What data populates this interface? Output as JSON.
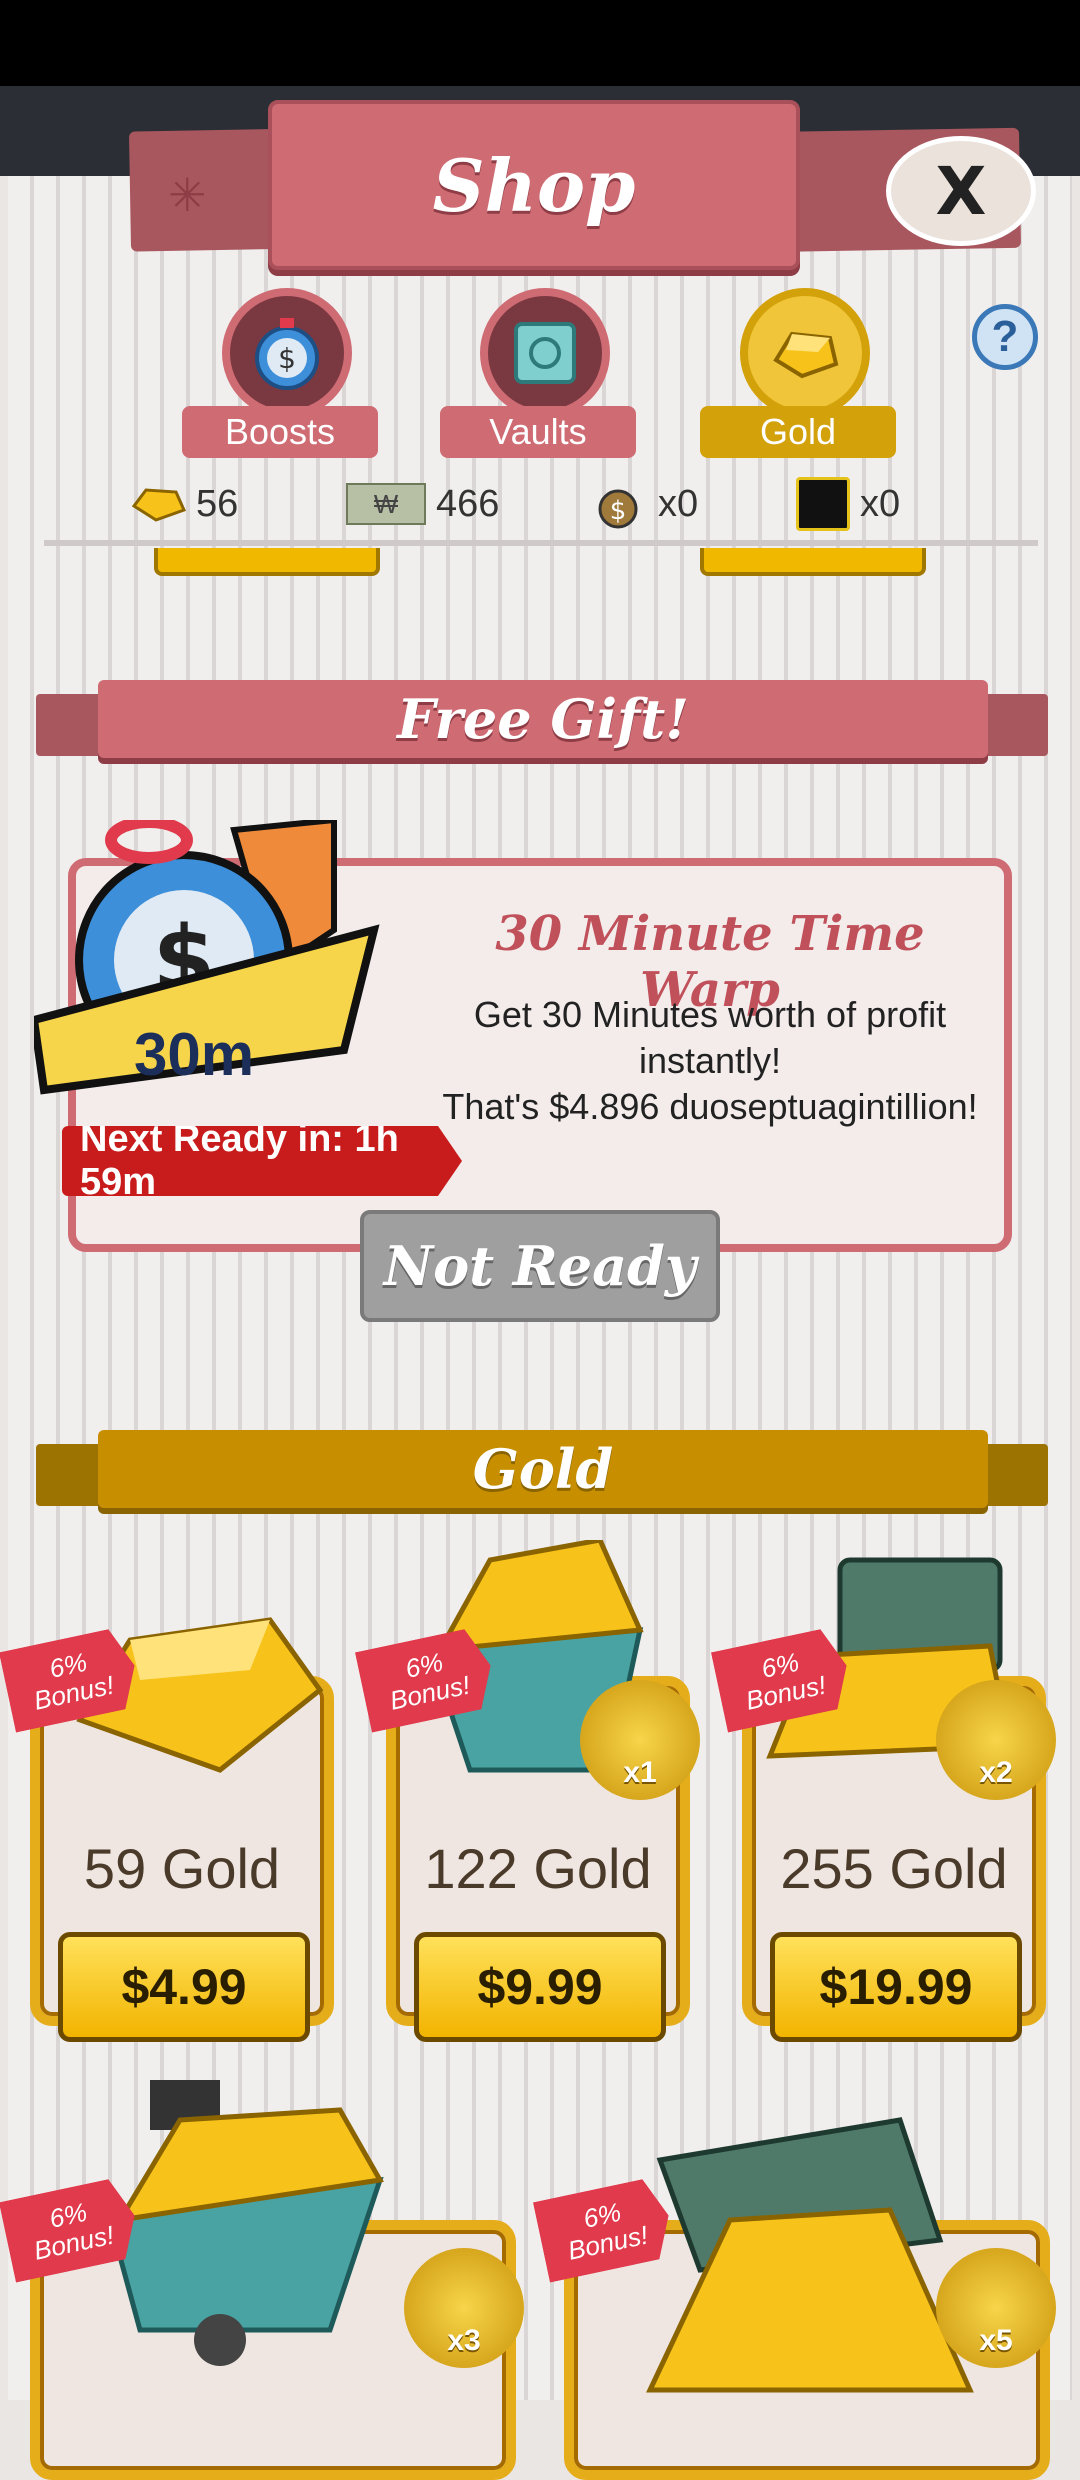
{
  "shop": {
    "title": "Shop",
    "close_label": "X",
    "help_label": "?"
  },
  "tabs": [
    {
      "label": "Boosts",
      "icon": "stopwatch-icon",
      "active": false
    },
    {
      "label": "Vaults",
      "icon": "vault-icon",
      "active": false
    },
    {
      "label": "Gold",
      "icon": "gold-icon",
      "active": true
    }
  ],
  "currencies": [
    {
      "icon": "gold-icon",
      "value": "56"
    },
    {
      "icon": "megabucks-icon",
      "glyph": "₩",
      "value": "466"
    },
    {
      "icon": "moneybag-icon",
      "value": "x0"
    },
    {
      "icon": "badge-icon",
      "value": "x0"
    }
  ],
  "free_gift": {
    "header": "Free Gift!",
    "title": "30 Minute Time Warp",
    "desc_line1": "Get 30 Minutes worth of profit",
    "desc_line2": "instantly!",
    "desc_line3": "That's $4.896 duoseptuagintillion!",
    "icon_label": "30m",
    "next_ready": "Next Ready in: 1h 59m",
    "button": "Not Ready"
  },
  "gold_section": {
    "header": "Gold",
    "items": [
      {
        "amount": "59 Gold",
        "price": "$4.99",
        "bonus_pct": "6%",
        "bonus_word": "Bonus!",
        "multiplier": ""
      },
      {
        "amount": "122 Gold",
        "price": "$9.99",
        "bonus_pct": "6%",
        "bonus_word": "Bonus!",
        "multiplier": "x1"
      },
      {
        "amount": "255 Gold",
        "price": "$19.99",
        "bonus_pct": "6%",
        "bonus_word": "Bonus!",
        "multiplier": "x2"
      },
      {
        "amount": "",
        "price": "",
        "bonus_pct": "6%",
        "bonus_word": "Bonus!",
        "multiplier": "x3"
      },
      {
        "amount": "",
        "price": "",
        "bonus_pct": "6%",
        "bonus_word": "Bonus!",
        "multiplier": "x5"
      }
    ]
  },
  "colors": {
    "accent_red": "#cf6b73",
    "accent_gold": "#d3a10a",
    "price_button": "#f2b400"
  }
}
